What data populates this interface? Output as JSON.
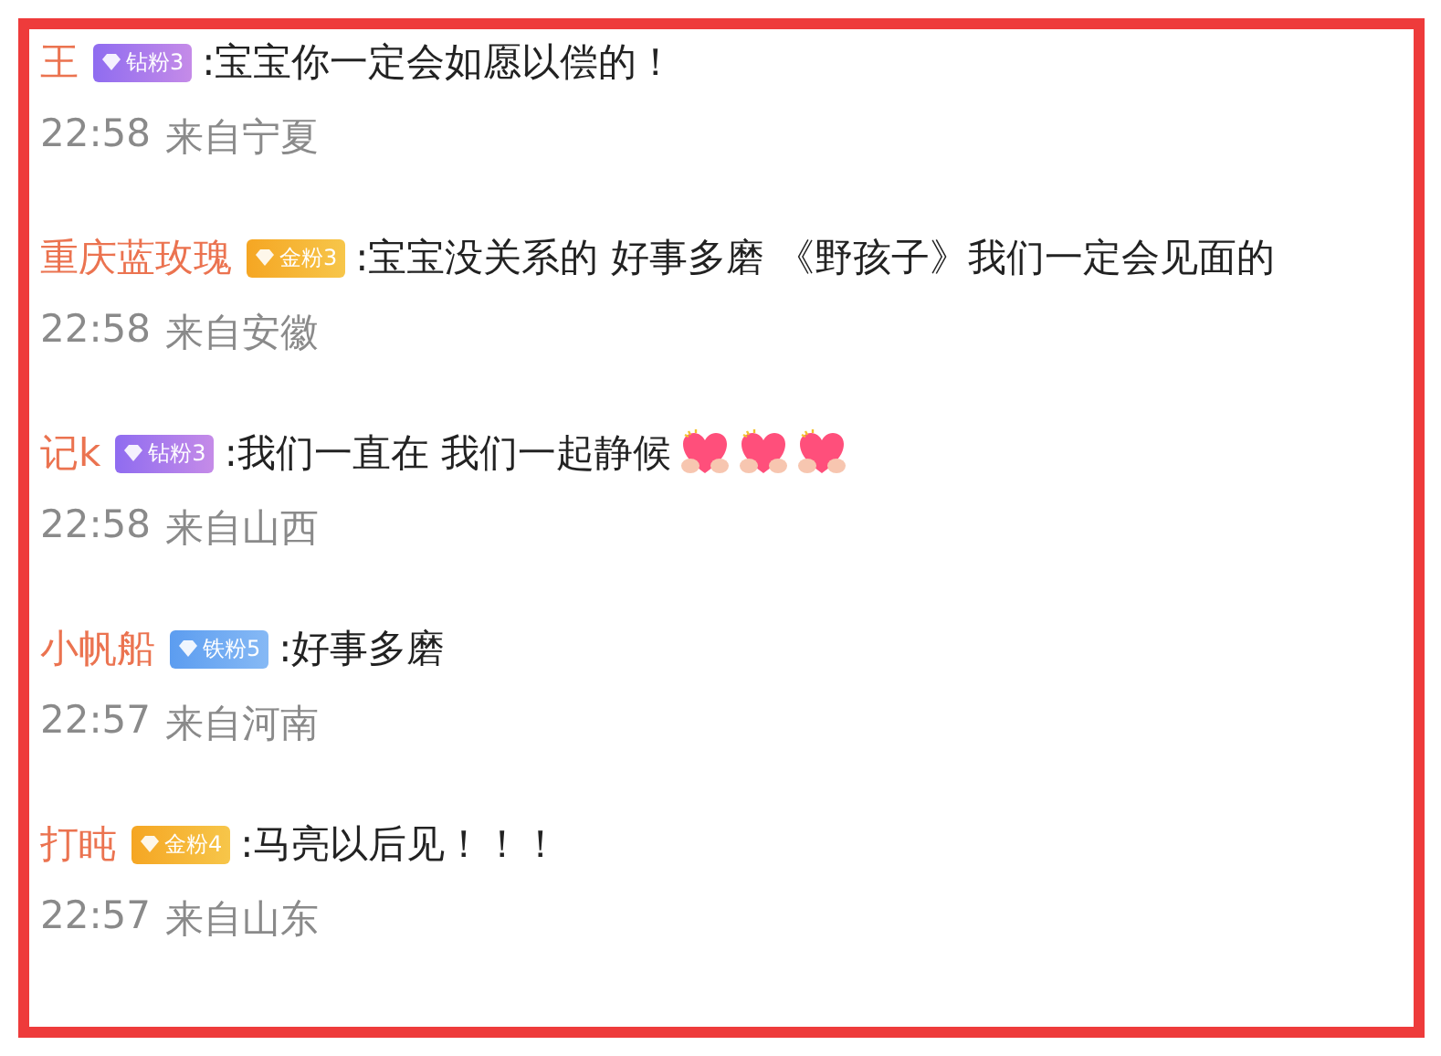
{
  "comments": [
    {
      "user": "王",
      "badge": {
        "kind": "diamond",
        "label": "钻粉3"
      },
      "text": ":宝宝你一定会如愿以偿的！",
      "time": "22:58",
      "location": "来自宁夏"
    },
    {
      "user": "重庆蓝玫瑰",
      "badge": {
        "kind": "gold",
        "label": "金粉3"
      },
      "text": ":宝宝没关系的 好事多磨 《野孩子》我们一定会见面的",
      "time": "22:58",
      "location": "来自安徽"
    },
    {
      "user": "记k",
      "badge": {
        "kind": "diamond",
        "label": "钻粉3"
      },
      "text": ":我们一直在 我们一起静候",
      "emojis": [
        {
          "kind": "heart-hands"
        },
        {
          "kind": "heart-hands"
        },
        {
          "kind": "heart-hands"
        }
      ],
      "time": "22:58",
      "location": "来自山西"
    },
    {
      "user": "小帆船",
      "badge": {
        "kind": "iron",
        "label": "铁粉5"
      },
      "text": ":好事多磨",
      "time": "22:57",
      "location": "来自河南"
    },
    {
      "user": "打盹",
      "badge": {
        "kind": "gold",
        "label": "金粉4"
      },
      "text": ":马亮以后见！！！",
      "time": "22:57",
      "location": "来自山东"
    }
  ]
}
